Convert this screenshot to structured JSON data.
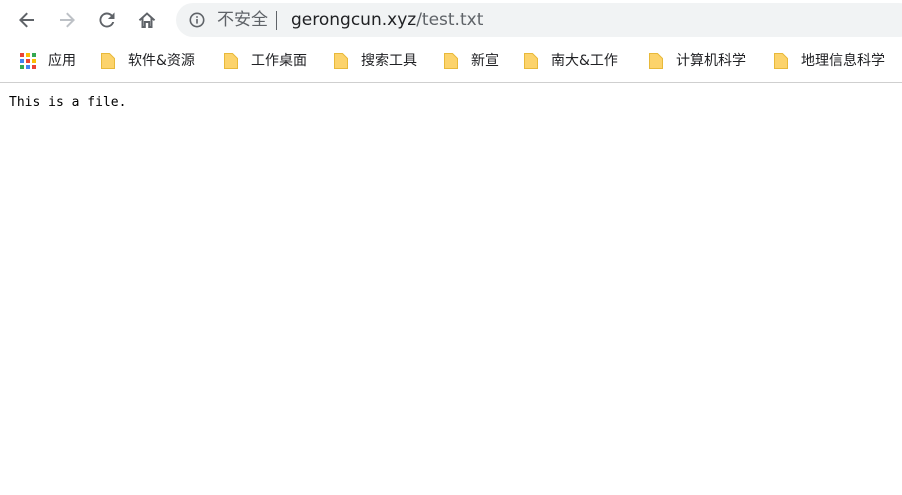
{
  "toolbar": {
    "back_icon": "arrow-left-icon",
    "forward_icon": "arrow-right-icon",
    "reload_icon": "reload-icon",
    "home_icon": "home-icon"
  },
  "omnibox": {
    "security_icon": "info-circle-icon",
    "security_label": "不安全",
    "url_domain": "gerongcun.xyz",
    "url_path": "/test.txt"
  },
  "bookmarks": {
    "apps_label": "应用",
    "items": [
      {
        "label": "软件&资源",
        "icon": "folder-icon"
      },
      {
        "label": "工作桌面",
        "icon": "folder-icon"
      },
      {
        "label": "搜索工具",
        "icon": "folder-icon"
      },
      {
        "label": "新宣",
        "icon": "folder-icon"
      },
      {
        "label": "南大&工作",
        "icon": "folder-icon"
      },
      {
        "label": "计算机科学",
        "icon": "folder-icon"
      },
      {
        "label": "地理信息科学",
        "icon": "folder-icon"
      }
    ]
  },
  "page": {
    "content_text": "This is a file."
  },
  "colors": {
    "folder_fill": "#fcd36b",
    "folder_edge": "#e8b93a",
    "omnibox_bg": "#f1f3f4",
    "apps_grid": [
      "#ea4335",
      "#fbbc04",
      "#34a853",
      "#4285f4",
      "#ea4335",
      "#fbbc04",
      "#34a853",
      "#4285f4",
      "#ea4335"
    ]
  }
}
